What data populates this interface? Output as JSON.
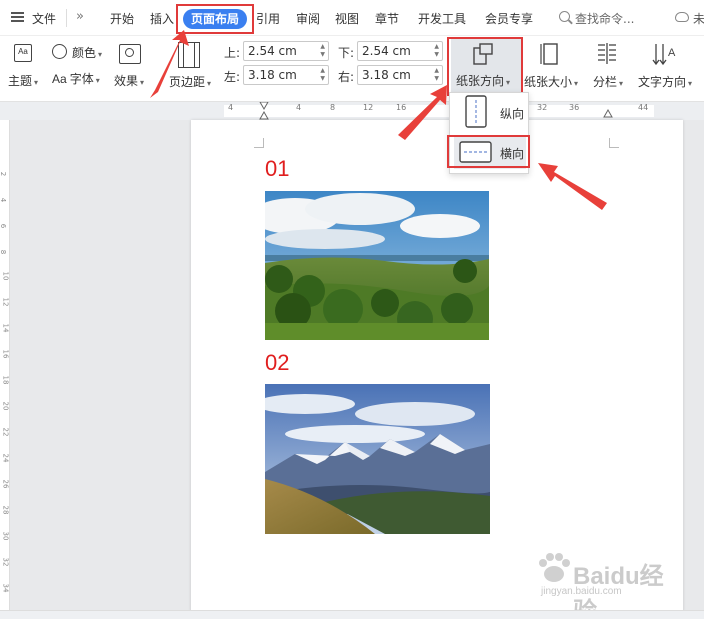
{
  "menubar": {
    "file": "文件",
    "tabs": [
      "开始",
      "插入",
      "页面布局",
      "引用",
      "审阅",
      "视图",
      "章节",
      "开发工具",
      "会员专享"
    ],
    "search_placeholder": "查找命令...",
    "cloud_label": "未"
  },
  "toolbar": {
    "theme": "主题",
    "color": "颜色",
    "font": "字体",
    "font_prefix": "Aa",
    "effect": "效果",
    "margins": "页边距",
    "top_label": "上:",
    "top_value": "2.54 cm",
    "bottom_label": "下:",
    "bottom_value": "2.54 cm",
    "left_label": "左:",
    "left_value": "3.18 cm",
    "right_label": "右:",
    "right_value": "3.18 cm",
    "orientation": "纸张方向",
    "paper_size": "纸张大小",
    "columns": "分栏",
    "text_direction": "文字方向"
  },
  "ruler": {
    "numbers": [
      "4",
      "4",
      "8",
      "12",
      "16",
      "32",
      "36",
      "44"
    ]
  },
  "vruler": {
    "numbers": [
      "2",
      "4",
      "6",
      "8",
      "10",
      "12",
      "14",
      "16",
      "18",
      "20",
      "22",
      "24",
      "26",
      "28",
      "30",
      "32",
      "34"
    ]
  },
  "document": {
    "label1": "01",
    "label2": "02"
  },
  "dropdown": {
    "portrait": "纵向",
    "landscape": "横向"
  },
  "watermark": {
    "text": "Baidu经验",
    "sub": "jingyan.baidu.com"
  },
  "colors": {
    "accent": "#3a7ff0",
    "highlight": "#e03a3a",
    "label_red": "#e01e1e"
  }
}
